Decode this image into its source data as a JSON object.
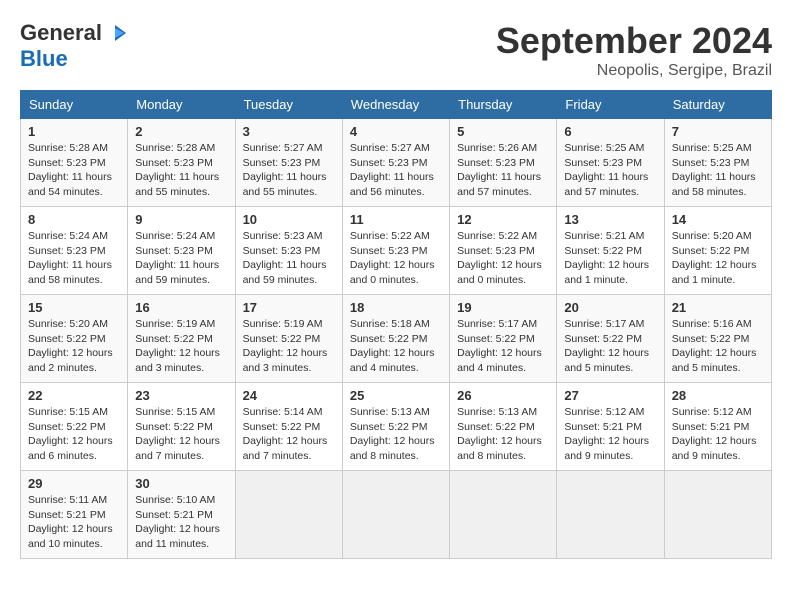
{
  "logo": {
    "general": "General",
    "blue": "Blue"
  },
  "title": "September 2024",
  "location": "Neopolis, Sergipe, Brazil",
  "days_of_week": [
    "Sunday",
    "Monday",
    "Tuesday",
    "Wednesday",
    "Thursday",
    "Friday",
    "Saturday"
  ],
  "weeks": [
    [
      {
        "day": "1",
        "sunrise": "5:28 AM",
        "sunset": "5:23 PM",
        "daylight": "11 hours and 54 minutes."
      },
      {
        "day": "2",
        "sunrise": "5:28 AM",
        "sunset": "5:23 PM",
        "daylight": "11 hours and 55 minutes."
      },
      {
        "day": "3",
        "sunrise": "5:27 AM",
        "sunset": "5:23 PM",
        "daylight": "11 hours and 55 minutes."
      },
      {
        "day": "4",
        "sunrise": "5:27 AM",
        "sunset": "5:23 PM",
        "daylight": "11 hours and 56 minutes."
      },
      {
        "day": "5",
        "sunrise": "5:26 AM",
        "sunset": "5:23 PM",
        "daylight": "11 hours and 57 minutes."
      },
      {
        "day": "6",
        "sunrise": "5:25 AM",
        "sunset": "5:23 PM",
        "daylight": "11 hours and 57 minutes."
      },
      {
        "day": "7",
        "sunrise": "5:25 AM",
        "sunset": "5:23 PM",
        "daylight": "11 hours and 58 minutes."
      }
    ],
    [
      {
        "day": "8",
        "sunrise": "5:24 AM",
        "sunset": "5:23 PM",
        "daylight": "11 hours and 58 minutes."
      },
      {
        "day": "9",
        "sunrise": "5:24 AM",
        "sunset": "5:23 PM",
        "daylight": "11 hours and 59 minutes."
      },
      {
        "day": "10",
        "sunrise": "5:23 AM",
        "sunset": "5:23 PM",
        "daylight": "11 hours and 59 minutes."
      },
      {
        "day": "11",
        "sunrise": "5:22 AM",
        "sunset": "5:23 PM",
        "daylight": "12 hours and 0 minutes."
      },
      {
        "day": "12",
        "sunrise": "5:22 AM",
        "sunset": "5:23 PM",
        "daylight": "12 hours and 0 minutes."
      },
      {
        "day": "13",
        "sunrise": "5:21 AM",
        "sunset": "5:22 PM",
        "daylight": "12 hours and 1 minute."
      },
      {
        "day": "14",
        "sunrise": "5:20 AM",
        "sunset": "5:22 PM",
        "daylight": "12 hours and 1 minute."
      }
    ],
    [
      {
        "day": "15",
        "sunrise": "5:20 AM",
        "sunset": "5:22 PM",
        "daylight": "12 hours and 2 minutes."
      },
      {
        "day": "16",
        "sunrise": "5:19 AM",
        "sunset": "5:22 PM",
        "daylight": "12 hours and 3 minutes."
      },
      {
        "day": "17",
        "sunrise": "5:19 AM",
        "sunset": "5:22 PM",
        "daylight": "12 hours and 3 minutes."
      },
      {
        "day": "18",
        "sunrise": "5:18 AM",
        "sunset": "5:22 PM",
        "daylight": "12 hours and 4 minutes."
      },
      {
        "day": "19",
        "sunrise": "5:17 AM",
        "sunset": "5:22 PM",
        "daylight": "12 hours and 4 minutes."
      },
      {
        "day": "20",
        "sunrise": "5:17 AM",
        "sunset": "5:22 PM",
        "daylight": "12 hours and 5 minutes."
      },
      {
        "day": "21",
        "sunrise": "5:16 AM",
        "sunset": "5:22 PM",
        "daylight": "12 hours and 5 minutes."
      }
    ],
    [
      {
        "day": "22",
        "sunrise": "5:15 AM",
        "sunset": "5:22 PM",
        "daylight": "12 hours and 6 minutes."
      },
      {
        "day": "23",
        "sunrise": "5:15 AM",
        "sunset": "5:22 PM",
        "daylight": "12 hours and 7 minutes."
      },
      {
        "day": "24",
        "sunrise": "5:14 AM",
        "sunset": "5:22 PM",
        "daylight": "12 hours and 7 minutes."
      },
      {
        "day": "25",
        "sunrise": "5:13 AM",
        "sunset": "5:22 PM",
        "daylight": "12 hours and 8 minutes."
      },
      {
        "day": "26",
        "sunrise": "5:13 AM",
        "sunset": "5:22 PM",
        "daylight": "12 hours and 8 minutes."
      },
      {
        "day": "27",
        "sunrise": "5:12 AM",
        "sunset": "5:21 PM",
        "daylight": "12 hours and 9 minutes."
      },
      {
        "day": "28",
        "sunrise": "5:12 AM",
        "sunset": "5:21 PM",
        "daylight": "12 hours and 9 minutes."
      }
    ],
    [
      {
        "day": "29",
        "sunrise": "5:11 AM",
        "sunset": "5:21 PM",
        "daylight": "12 hours and 10 minutes."
      },
      {
        "day": "30",
        "sunrise": "5:10 AM",
        "sunset": "5:21 PM",
        "daylight": "12 hours and 11 minutes."
      },
      null,
      null,
      null,
      null,
      null
    ]
  ]
}
